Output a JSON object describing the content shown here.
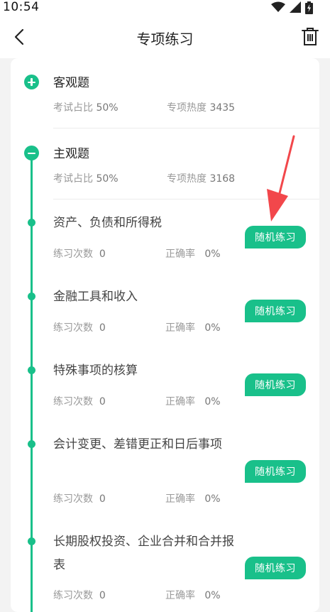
{
  "status": {
    "time": "10:54"
  },
  "nav": {
    "title": "专项练习"
  },
  "groups": [
    {
      "title": "客观题",
      "ratio_label": "考试占比",
      "ratio": "50%",
      "heat_label": "专项热度",
      "heat": "3435",
      "icon": "plus-circle-icon"
    },
    {
      "title": "主观题",
      "ratio_label": "考试占比",
      "ratio": "50%",
      "heat_label": "专项热度",
      "heat": "3168",
      "icon": "minus-circle-icon"
    }
  ],
  "items": [
    {
      "title": "资产、负债和所得税",
      "count_label": "练习次数",
      "count": "0",
      "acc_label": "正确率",
      "acc": "0%",
      "button": "随机练习"
    },
    {
      "title": "金融工具和收入",
      "count_label": "练习次数",
      "count": "0",
      "acc_label": "正确率",
      "acc": "0%",
      "button": "随机练习"
    },
    {
      "title": "特殊事项的核算",
      "count_label": "练习次数",
      "count": "0",
      "acc_label": "正确率",
      "acc": "0%",
      "button": "随机练习"
    },
    {
      "title": "会计变更、差错更正和日后事项",
      "count_label": "练习次数",
      "count": "0",
      "acc_label": "正确率",
      "acc": "0%",
      "button": "随机练习"
    },
    {
      "title": "长期股权投资、企业合并和合并报表",
      "count_label": "练习次数",
      "count": "0",
      "acc_label": "正确率",
      "acc": "0%",
      "button": "随机练习"
    }
  ],
  "colors": {
    "accent": "#19c08a",
    "annotation_arrow": "#f2474b"
  }
}
